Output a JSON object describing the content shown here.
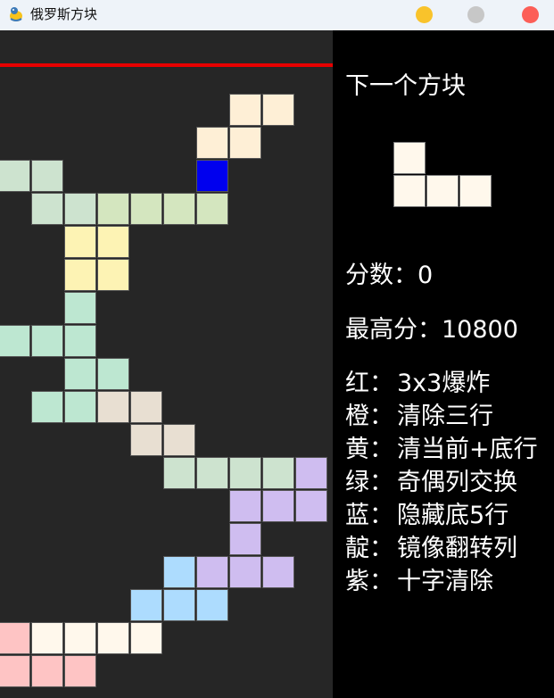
{
  "window": {
    "title": "俄罗斯方块",
    "icon": "snake-game-icon",
    "buttons": {
      "minimize_color": "#f9c32b",
      "maximize_color": "#c7c7c7",
      "close_color": "#fc5e57"
    }
  },
  "board": {
    "background": "#262626",
    "danger_line_color": "#e60000",
    "cell_unit": 37,
    "cells": [
      {
        "col": 7,
        "row": 2,
        "color": "#feefd6"
      },
      {
        "col": 8,
        "row": 2,
        "color": "#feefd6"
      },
      {
        "col": 6,
        "row": 3,
        "color": "#feefd6"
      },
      {
        "col": 7,
        "row": 3,
        "color": "#feefd6"
      },
      {
        "col": 0,
        "row": 4,
        "color": "#cde3cf"
      },
      {
        "col": 1,
        "row": 4,
        "color": "#cde3cf"
      },
      {
        "col": 6,
        "row": 4,
        "color": "#0000ee"
      },
      {
        "col": 1,
        "row": 5,
        "color": "#cde3cf"
      },
      {
        "col": 2,
        "row": 5,
        "color": "#cde3cf"
      },
      {
        "col": 3,
        "row": 5,
        "color": "#d4e6bf"
      },
      {
        "col": 4,
        "row": 5,
        "color": "#d4e6bf"
      },
      {
        "col": 5,
        "row": 5,
        "color": "#d4e6bf"
      },
      {
        "col": 6,
        "row": 5,
        "color": "#d4e6bf"
      },
      {
        "col": 2,
        "row": 6,
        "color": "#fdf3b4"
      },
      {
        "col": 3,
        "row": 6,
        "color": "#fdf3b4"
      },
      {
        "col": 2,
        "row": 7,
        "color": "#fdf3b4"
      },
      {
        "col": 3,
        "row": 7,
        "color": "#fdf3b4"
      },
      {
        "col": 2,
        "row": 8,
        "color": "#bde7d1"
      },
      {
        "col": 0,
        "row": 9,
        "color": "#bde7d1"
      },
      {
        "col": 1,
        "row": 9,
        "color": "#bde7d1"
      },
      {
        "col": 2,
        "row": 9,
        "color": "#bde7d1"
      },
      {
        "col": 2,
        "row": 10,
        "color": "#bde7d1"
      },
      {
        "col": 3,
        "row": 10,
        "color": "#bde7d1"
      },
      {
        "col": 1,
        "row": 11,
        "color": "#bde7d1"
      },
      {
        "col": 2,
        "row": 11,
        "color": "#bde7d1"
      },
      {
        "col": 3,
        "row": 11,
        "color": "#e8dfd2"
      },
      {
        "col": 4,
        "row": 11,
        "color": "#e8dfd2"
      },
      {
        "col": 4,
        "row": 12,
        "color": "#e8dfd2"
      },
      {
        "col": 5,
        "row": 12,
        "color": "#e8dfd2"
      },
      {
        "col": 5,
        "row": 13,
        "color": "#cde3cf"
      },
      {
        "col": 6,
        "row": 13,
        "color": "#cde3cf"
      },
      {
        "col": 7,
        "row": 13,
        "color": "#cde3cf"
      },
      {
        "col": 8,
        "row": 13,
        "color": "#cde3cf"
      },
      {
        "col": 9,
        "row": 13,
        "color": "#cfbdf0"
      },
      {
        "col": 7,
        "row": 14,
        "color": "#cfbdf0"
      },
      {
        "col": 8,
        "row": 14,
        "color": "#cfbdf0"
      },
      {
        "col": 9,
        "row": 14,
        "color": "#cfbdf0"
      },
      {
        "col": 7,
        "row": 15,
        "color": "#cfbdf0"
      },
      {
        "col": 5,
        "row": 16,
        "color": "#addcfe"
      },
      {
        "col": 6,
        "row": 16,
        "color": "#cfbdf0"
      },
      {
        "col": 7,
        "row": 16,
        "color": "#cfbdf0"
      },
      {
        "col": 8,
        "row": 16,
        "color": "#cfbdf0"
      },
      {
        "col": 4,
        "row": 17,
        "color": "#addcfe"
      },
      {
        "col": 5,
        "row": 17,
        "color": "#addcfe"
      },
      {
        "col": 6,
        "row": 17,
        "color": "#addcfe"
      },
      {
        "col": 0,
        "row": 18,
        "color": "#fec4c4"
      },
      {
        "col": 1,
        "row": 18,
        "color": "#fff8ec"
      },
      {
        "col": 2,
        "row": 18,
        "color": "#fff8ec"
      },
      {
        "col": 3,
        "row": 18,
        "color": "#fff8ec"
      },
      {
        "col": 4,
        "row": 18,
        "color": "#fff8ec"
      },
      {
        "col": 0,
        "row": 19,
        "color": "#fec4c4"
      },
      {
        "col": 1,
        "row": 19,
        "color": "#fec4c4"
      },
      {
        "col": 2,
        "row": 19,
        "color": "#fec4c4"
      }
    ]
  },
  "panel": {
    "next_label": "下一个方块",
    "next_piece": {
      "color": "#fff8ec",
      "cells": [
        {
          "col": 0,
          "row": 0
        },
        {
          "col": 0,
          "row": 1
        },
        {
          "col": 1,
          "row": 1
        },
        {
          "col": 2,
          "row": 1
        }
      ]
    },
    "score_label": "分数：",
    "score": "0",
    "best_label": "最高分：",
    "best": "10800",
    "legend": [
      {
        "key": "红：",
        "desc": "3x3爆炸"
      },
      {
        "key": "橙：",
        "desc": "清除三行"
      },
      {
        "key": "黄：",
        "desc": "清当前+底行"
      },
      {
        "key": "绿：",
        "desc": "奇偶列交换"
      },
      {
        "key": "蓝：",
        "desc": "隐藏底5行"
      },
      {
        "key": "靛：",
        "desc": "镜像翻转列"
      },
      {
        "key": "紫：",
        "desc": "十字清除"
      }
    ]
  }
}
